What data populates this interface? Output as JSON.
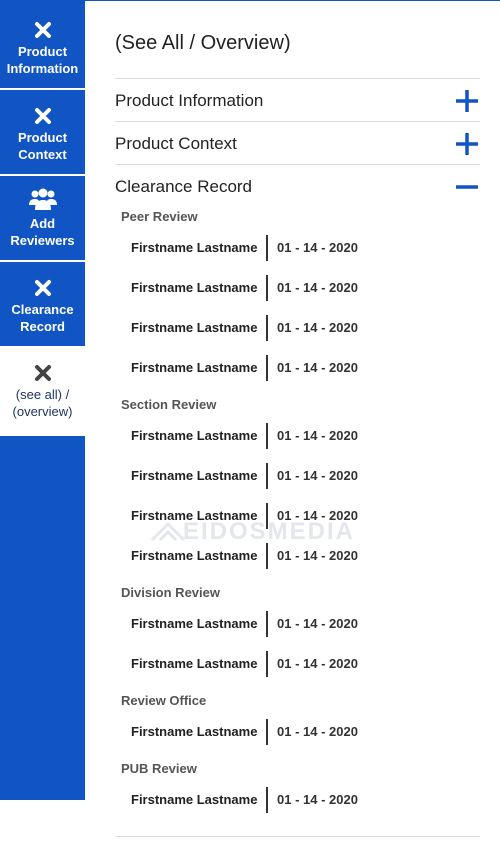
{
  "sidebar": {
    "items": [
      {
        "label_line1": "Product",
        "label_line2": "Information",
        "icon": "close-icon"
      },
      {
        "label_line1": "Product",
        "label_line2": "Context",
        "icon": "close-icon"
      },
      {
        "label_line1": "Add",
        "label_line2": "Reviewers",
        "icon": "people-icon"
      },
      {
        "label_line1": "Clearance",
        "label_line2": "Record",
        "icon": "close-icon"
      },
      {
        "label_line1": "(see all) /",
        "label_line2": "(overview)",
        "icon": "close-icon",
        "active": true
      }
    ]
  },
  "main": {
    "title": "(See All / Overview)",
    "sections": [
      {
        "label": "Product Information",
        "state": "collapsed"
      },
      {
        "label": "Product Context",
        "state": "collapsed"
      },
      {
        "label": "Clearance Record",
        "state": "expanded"
      }
    ],
    "clearance_record": {
      "groups": [
        {
          "title": "Peer Review",
          "reviewers": [
            {
              "name": "Firstname Lastname",
              "date": "01 - 14 - 2020"
            },
            {
              "name": "Firstname Lastname",
              "date": "01 - 14 - 2020"
            },
            {
              "name": "Firstname Lastname",
              "date": "01 - 14 - 2020"
            },
            {
              "name": "Firstname Lastname",
              "date": "01 - 14 - 2020"
            }
          ]
        },
        {
          "title": "Section Review",
          "reviewers": [
            {
              "name": "Firstname Lastname",
              "date": "01 - 14 - 2020"
            },
            {
              "name": "Firstname Lastname",
              "date": "01 - 14 - 2020"
            },
            {
              "name": "Firstname Lastname",
              "date": "01 - 14 - 2020"
            },
            {
              "name": "Firstname Lastname",
              "date": "01 - 14 - 2020"
            }
          ]
        },
        {
          "title": "Division Review",
          "reviewers": [
            {
              "name": "Firstname Lastname",
              "date": "01 - 14 - 2020"
            },
            {
              "name": "Firstname Lastname",
              "date": "01 - 14 - 2020"
            }
          ]
        },
        {
          "title": "Review Office",
          "reviewers": [
            {
              "name": "Firstname Lastname",
              "date": "01 - 14 - 2020"
            }
          ]
        },
        {
          "title": "PUB Review",
          "reviewers": [
            {
              "name": "Firstname Lastname",
              "date": "01 - 14 - 2020"
            }
          ]
        }
      ]
    }
  },
  "watermark": "EIDOSMEDIA",
  "colors": {
    "accent": "#1155c4",
    "sidebar_bg": "#1155c4",
    "active_text": "#1f3560",
    "divider": "#dcdcdc"
  }
}
